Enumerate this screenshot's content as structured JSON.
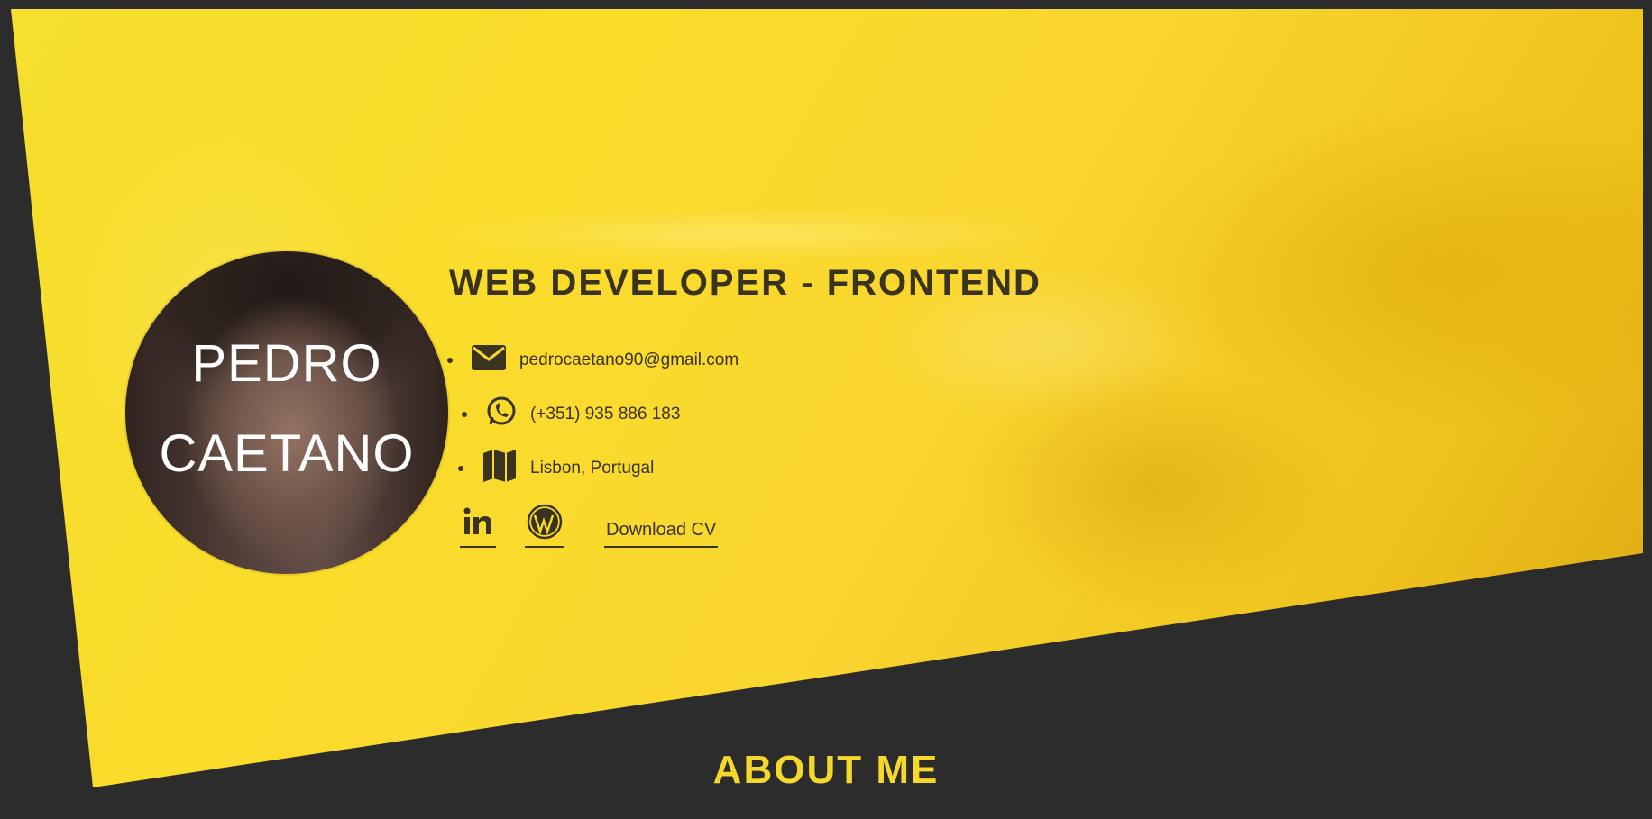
{
  "hero": {
    "name_first": "PEDRO",
    "name_last": "CAETANO",
    "title": "WEB DEVELOPER - FRONTEND",
    "contacts": [
      {
        "icon": "envelope-icon",
        "text": "pedrocaetano90@gmail.com"
      },
      {
        "icon": "whatsapp-icon",
        "text": "(+351) 935 886 183"
      },
      {
        "icon": "map-icon",
        "text": "Lisbon, Portugal"
      }
    ],
    "social": {
      "linkedin_icon": "linkedin-icon",
      "wordpress_icon": "wordpress-icon",
      "download_label": "Download CV"
    }
  },
  "about": {
    "title": "ABOUT ME"
  },
  "colors": {
    "accent": "#f5d82a",
    "dark_background": "#2c2c2c",
    "text_dark": "#3a3320"
  }
}
